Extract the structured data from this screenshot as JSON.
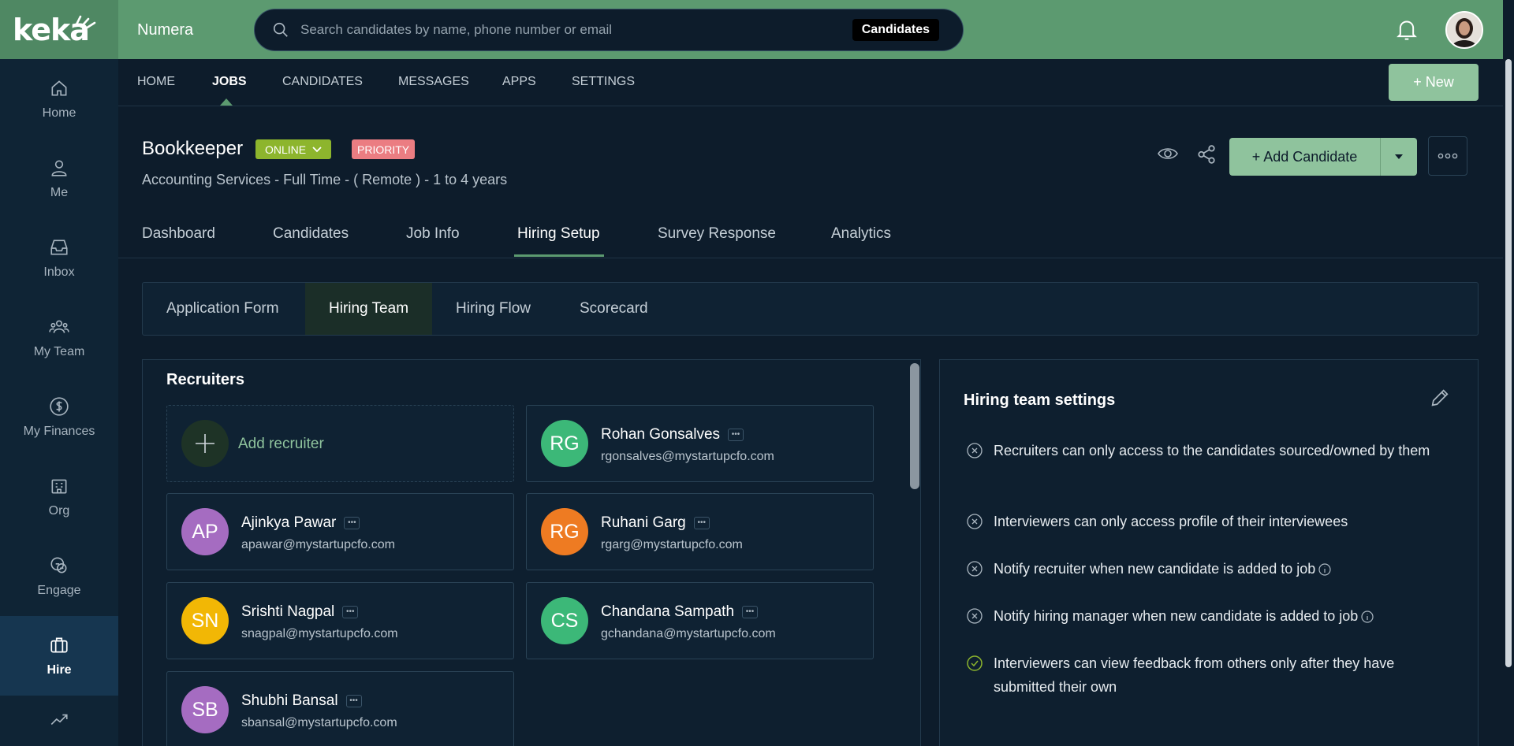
{
  "brand": {
    "logo_text": "keka",
    "org_name": "Numera"
  },
  "search": {
    "placeholder": "Search candidates by name, phone number or email",
    "scope_chip": "Candidates"
  },
  "sidebar": {
    "items": [
      {
        "label": "Home",
        "icon": "home-icon"
      },
      {
        "label": "Me",
        "icon": "user-icon"
      },
      {
        "label": "Inbox",
        "icon": "inbox-icon"
      },
      {
        "label": "My Team",
        "icon": "team-icon"
      },
      {
        "label": "My Finances",
        "icon": "dollar-icon"
      },
      {
        "label": "Org",
        "icon": "building-icon"
      },
      {
        "label": "Engage",
        "icon": "chat-icon"
      },
      {
        "label": "Hire",
        "icon": "briefcase-icon",
        "active": true
      }
    ]
  },
  "mainnav": {
    "items": [
      "HOME",
      "JOBS",
      "CANDIDATES",
      "MESSAGES",
      "APPS",
      "SETTINGS"
    ],
    "active": "JOBS",
    "new_button": "+ New"
  },
  "job": {
    "title": "Bookkeeper",
    "status": "ONLINE",
    "priority": "PRIORITY",
    "subtitle": "Accounting Services - Full Time - ( Remote ) - 1 to 4 years",
    "add_candidate": "+ Add Candidate"
  },
  "tabs": {
    "items": [
      "Dashboard",
      "Candidates",
      "Job Info",
      "Hiring Setup",
      "Survey Response",
      "Analytics"
    ],
    "active": "Hiring Setup"
  },
  "subtabs": {
    "items": [
      "Application Form",
      "Hiring Team",
      "Hiring Flow",
      "Scorecard"
    ],
    "active": "Hiring Team"
  },
  "recruiters": {
    "title": "Recruiters",
    "add_label": "Add recruiter",
    "people": [
      {
        "initials": "RG",
        "name": "Rohan Gonsalves",
        "email": "rgonsalves@mystartupcfo.com",
        "color": "#3cb878"
      },
      {
        "initials": "AP",
        "name": "Ajinkya Pawar",
        "email": "apawar@mystartupcfo.com",
        "color": "#a56cc1"
      },
      {
        "initials": "RG",
        "name": "Ruhani Garg",
        "email": "rgarg@mystartupcfo.com",
        "color": "#ee7b22"
      },
      {
        "initials": "SN",
        "name": "Srishti Nagpal",
        "email": "snagpal@mystartupcfo.com",
        "color": "#f2b705"
      },
      {
        "initials": "CS",
        "name": "Chandana Sampath",
        "email": "gchandana@mystartupcfo.com",
        "color": "#3cb878"
      },
      {
        "initials": "SB",
        "name": "Shubhi Bansal",
        "email": "sbansal@mystartupcfo.com",
        "color": "#a56cc1"
      }
    ]
  },
  "settings": {
    "title": "Hiring team settings",
    "items": [
      {
        "text": "Recruiters can only access to the candidates sourced/owned by them",
        "enabled": false
      },
      {
        "text": "Interviewers can only access profile of their interviewees",
        "enabled": false
      },
      {
        "text": "Notify recruiter when new candidate is added to job",
        "enabled": false,
        "info": true
      },
      {
        "text": "Notify hiring manager when new candidate is added to job",
        "enabled": false,
        "info": true
      },
      {
        "text": "Interviewers can view feedback from others only after they have submitted their own",
        "enabled": true
      }
    ]
  },
  "colors": {
    "brand_green": "#5c9a70",
    "accent_button": "#8fc39d",
    "online": "#8db52d",
    "priority": "#eb7d82"
  }
}
